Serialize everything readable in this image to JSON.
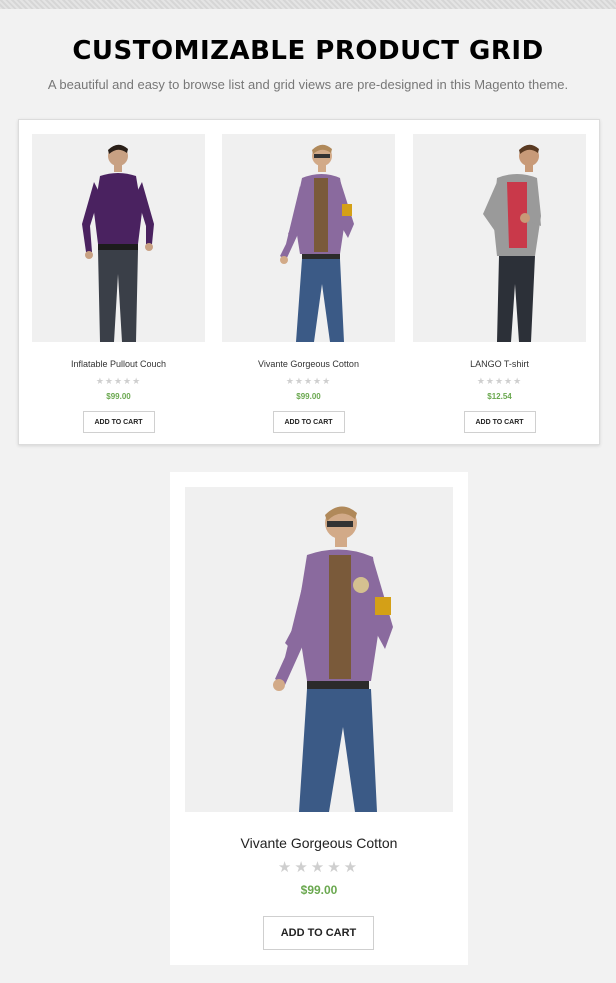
{
  "header": {
    "title": "CUSTOMIZABLE PRODUCT GRID",
    "subtitle": "A beautiful and easy to browse list and grid views are pre-designed in this Magento theme."
  },
  "grid": {
    "products": [
      {
        "name": "Inflatable Pullout Couch",
        "price": "$99.00",
        "rating": 0,
        "button": "ADD TO CART",
        "shirt_color": "#4a2260"
      },
      {
        "name": "Vivante Gorgeous Cotton",
        "price": "$99.00",
        "rating": 0,
        "button": "ADD TO CART",
        "shirt_color": "#8a6a9e"
      },
      {
        "name": "LANGO T-shirt",
        "price": "$12.54",
        "rating": 0,
        "button": "ADD TO CART",
        "shirt_color": "#9a9a9a"
      }
    ]
  },
  "featured": {
    "name": "Vivante Gorgeous Cotton",
    "price": "$99.00",
    "rating": 0,
    "button": "ADD TO CART",
    "shirt_color": "#8a6a9e"
  },
  "stars": "★★★★★",
  "colors": {
    "price": "#6aa84f",
    "star_empty": "#cfcfcf",
    "jeans": "#3b4f6b"
  }
}
